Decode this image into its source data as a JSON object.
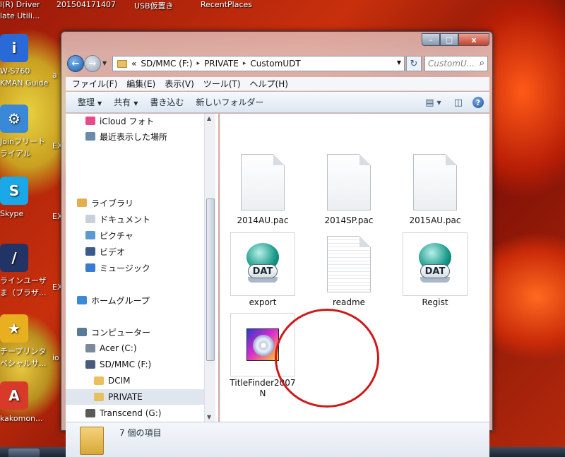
{
  "desktop": {
    "topbar": [
      "l(R) Driver",
      "201504171407",
      "USB仮置き",
      "RecentPlaces",
      "late Utili..."
    ],
    "icons": [
      {
        "label1": "W-S760",
        "label2": "KMAN Guide",
        "color": "#2a6ad8",
        "glyph": "i"
      },
      {
        "label1": "Joinフリート",
        "label2": "ライアル",
        "color": "#3a88d8",
        "glyph": "⚙"
      },
      {
        "label1": "Skype",
        "label2": "",
        "color": "#1aa8e8",
        "glyph": "S"
      },
      {
        "label1": "ラインユーザ",
        "label2": "ま（ブラザ...",
        "color": "#223366",
        "glyph": "/"
      },
      {
        "label1": "チープリンタ",
        "label2": "ペシャルサ...",
        "color": "#e8b020",
        "glyph": "★"
      },
      {
        "label1": "kakomon...",
        "label2": "",
        "color": "#d83a2a",
        "glyph": "A"
      }
    ],
    "side_labels": [
      "a",
      "EX",
      "EX",
      "EX",
      "io"
    ]
  },
  "window": {
    "controls": {
      "minimize": "–",
      "maximize": "□",
      "close": "x"
    },
    "nav": {
      "back": "←",
      "forward": "→",
      "dropdown": "▼"
    },
    "address": {
      "prefix": "«",
      "crumbs": [
        "SD/MMC (F:)",
        "PRIVATE",
        "CustomUDT"
      ],
      "separator": "▸",
      "dropdown": "▼"
    },
    "refresh_icon": "↻",
    "search": {
      "placeholder": "CustomU...",
      "icon": "⌕"
    },
    "menu": [
      "ファイル(F)",
      "編集(E)",
      "表示(V)",
      "ツール(T)",
      "ヘルプ(H)"
    ],
    "toolbar": {
      "organize": "整理",
      "share": "共有",
      "burn": "書き込む",
      "new_folder": "新しいフォルダー",
      "caret": "▼",
      "view_icon": "▤",
      "pane_icon": "◫",
      "help": "?"
    },
    "navpane": {
      "items": [
        {
          "label": "iCloud フォト",
          "indent": 1,
          "color": "#e84a8a"
        },
        {
          "label": "最近表示した場所",
          "indent": 1,
          "color": "#6a8aaa"
        },
        {
          "label": "ライブラリ",
          "indent": 0,
          "color": "#e0b050"
        },
        {
          "label": "ドキュメント",
          "indent": 1,
          "color": "#c8d0da"
        },
        {
          "label": "ピクチャ",
          "indent": 1,
          "color": "#5a9ad0"
        },
        {
          "label": "ビデオ",
          "indent": 1,
          "color": "#3a5a8a"
        },
        {
          "label": "ミュージック",
          "indent": 1,
          "color": "#3a7ad0"
        },
        {
          "label": "ホームグループ",
          "indent": 0,
          "color": "#3a8ad8"
        },
        {
          "label": "コンピューター",
          "indent": 0,
          "color": "#5a7a9a"
        },
        {
          "label": "Acer (C:)",
          "indent": 1,
          "color": "#7a8a9a"
        },
        {
          "label": "SD/MMC (F:)",
          "indent": 1,
          "color": "#4a5a7a"
        },
        {
          "label": "DCIM",
          "indent": 2,
          "color": "#e8c060"
        },
        {
          "label": "PRIVATE",
          "indent": 2,
          "color": "#e8c060"
        },
        {
          "label": "Transcend (G:)",
          "indent": 1,
          "color": "#5a5a5a"
        }
      ],
      "scroll_up": "▲",
      "scroll_down": "▼"
    },
    "files": [
      {
        "name": "2014AU.pac",
        "kind": "page"
      },
      {
        "name": "2014SP.pac",
        "kind": "page"
      },
      {
        "name": "2015AU.pac",
        "kind": "page"
      },
      {
        "name": "export",
        "kind": "dat",
        "badge": "DAT"
      },
      {
        "name": "readme",
        "kind": "text"
      },
      {
        "name": "Regist",
        "kind": "dat",
        "badge": "DAT"
      },
      {
        "name": "TitleFinder2007N",
        "kind": "disc"
      }
    ],
    "status": {
      "count": "7 個の項目"
    }
  }
}
